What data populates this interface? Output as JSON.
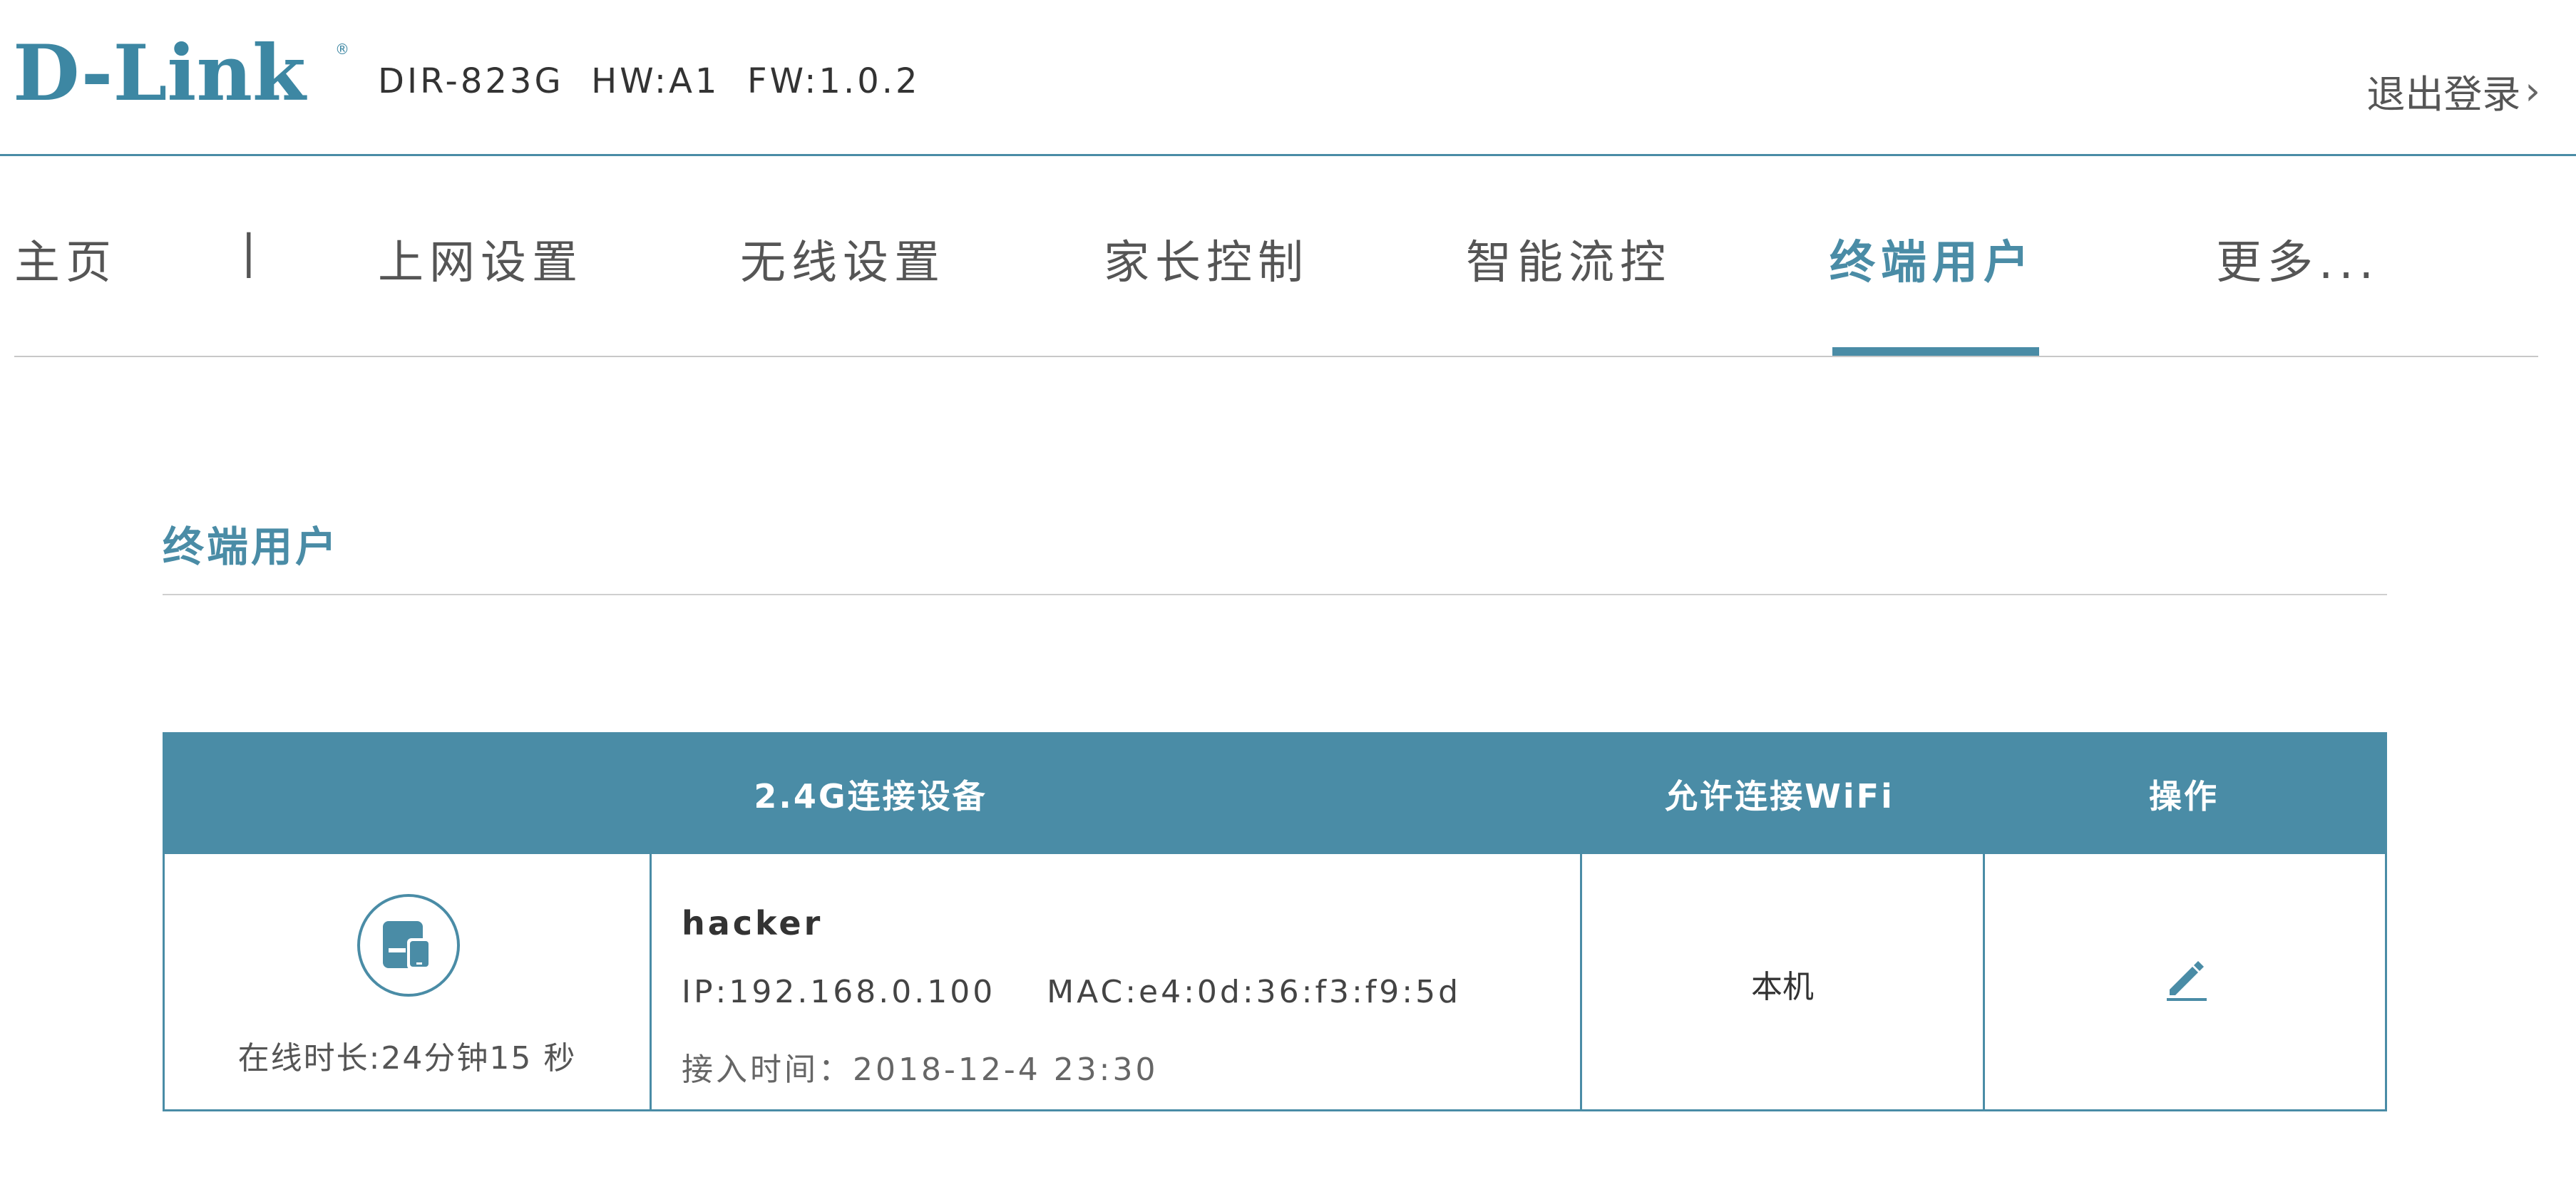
{
  "header": {
    "brand": "D-Link",
    "model_info": "DIR-823G  HW:A1  FW:1.0.2",
    "logout_label": "退出登录",
    "logout_chevron": "›"
  },
  "nav": {
    "items": [
      {
        "label": "主页"
      },
      {
        "label": "上网设置"
      },
      {
        "label": "无线设置"
      },
      {
        "label": "家长控制"
      },
      {
        "label": "智能流控"
      },
      {
        "label": "终端用户",
        "active": true
      },
      {
        "label": "更多..."
      }
    ],
    "separator": "|"
  },
  "section": {
    "title": "终端用户"
  },
  "table": {
    "headers": [
      "2.4G连接设备",
      "允许连接WiFi",
      "操作"
    ],
    "rows": [
      {
        "online_duration": "在线时长:24分钟15 秒",
        "name": "hacker",
        "ip_mac": "IP:192.168.0.100    MAC:e4:0d:36:f3:f9:5d",
        "connect_time": "接入时间：2018-12-4 23:30",
        "wifi": "本机",
        "device_icon": "device-icon",
        "action_icon": "edit-icon"
      }
    ]
  },
  "colors": {
    "accent": "#4a8ca6",
    "text": "#4a4a4a",
    "divider": "#cfcfcf"
  }
}
